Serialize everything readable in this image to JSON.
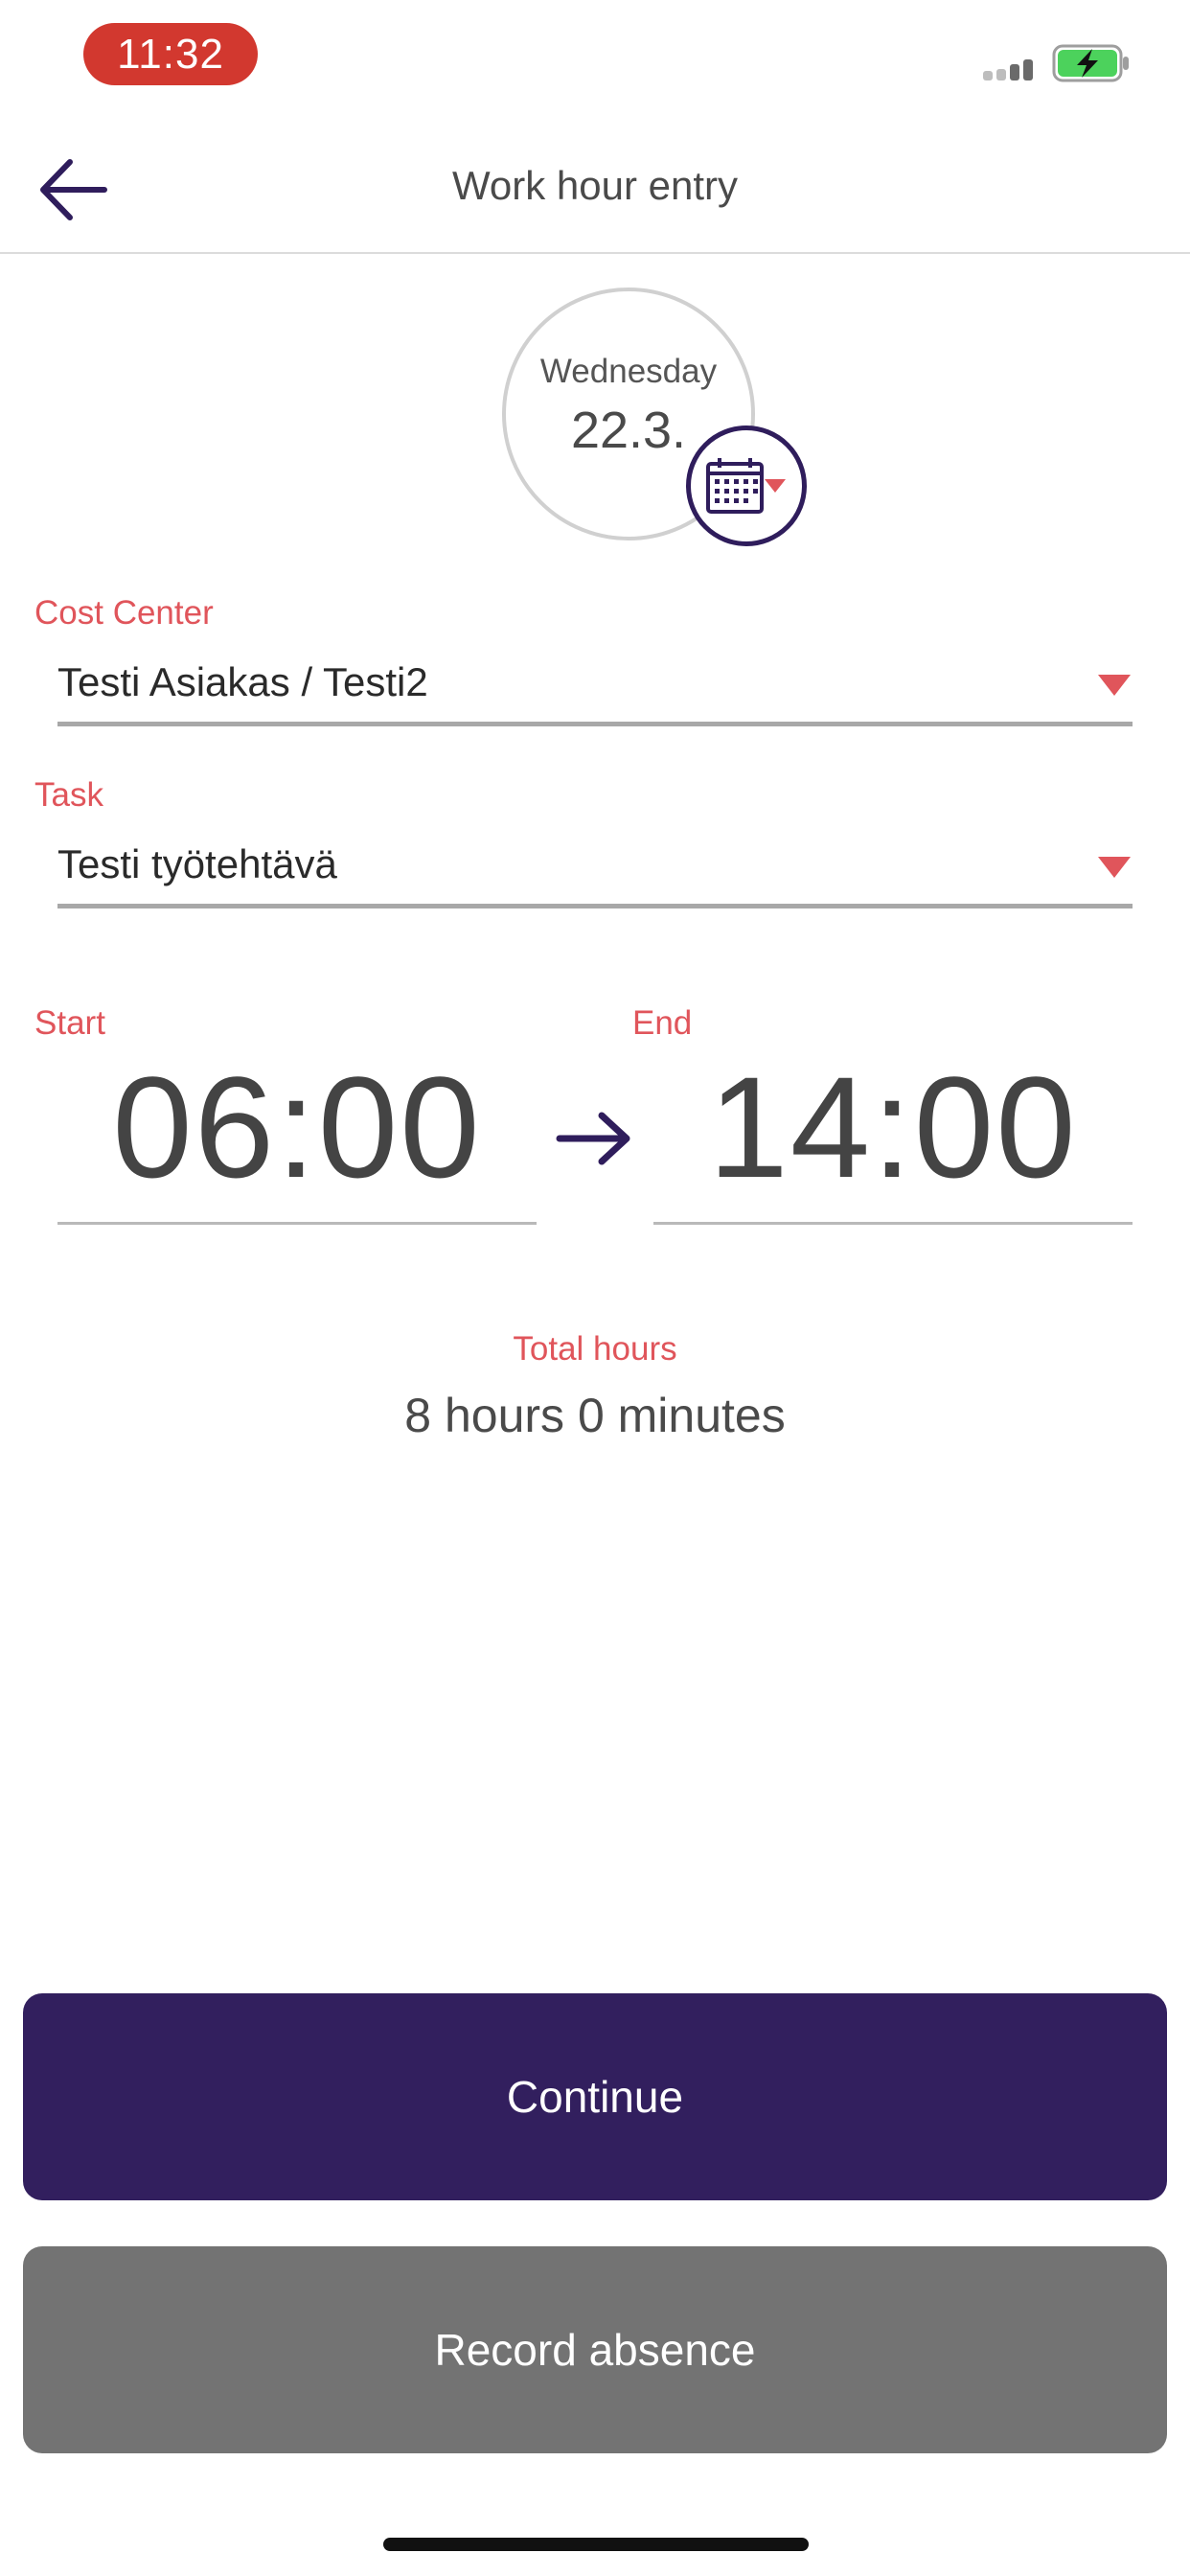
{
  "status_bar": {
    "time": "11:32"
  },
  "header": {
    "title": "Work hour entry"
  },
  "date": {
    "weekday": "Wednesday",
    "day": "22.3."
  },
  "cost_center": {
    "label": "Cost Center",
    "value": "Testi Asiakas / Testi2"
  },
  "task": {
    "label": "Task",
    "value": "Testi työtehtävä"
  },
  "time": {
    "start_label": "Start",
    "start_value": "06:00",
    "end_label": "End",
    "end_value": "14:00"
  },
  "total": {
    "label": "Total hours",
    "value": "8 hours 0 minutes"
  },
  "buttons": {
    "continue": "Continue",
    "record_absence": "Record absence"
  },
  "colors": {
    "accent": "#e0555b",
    "primary": "#321f5e",
    "secondary": "#737373",
    "status_time_bg": "#d2382f"
  }
}
